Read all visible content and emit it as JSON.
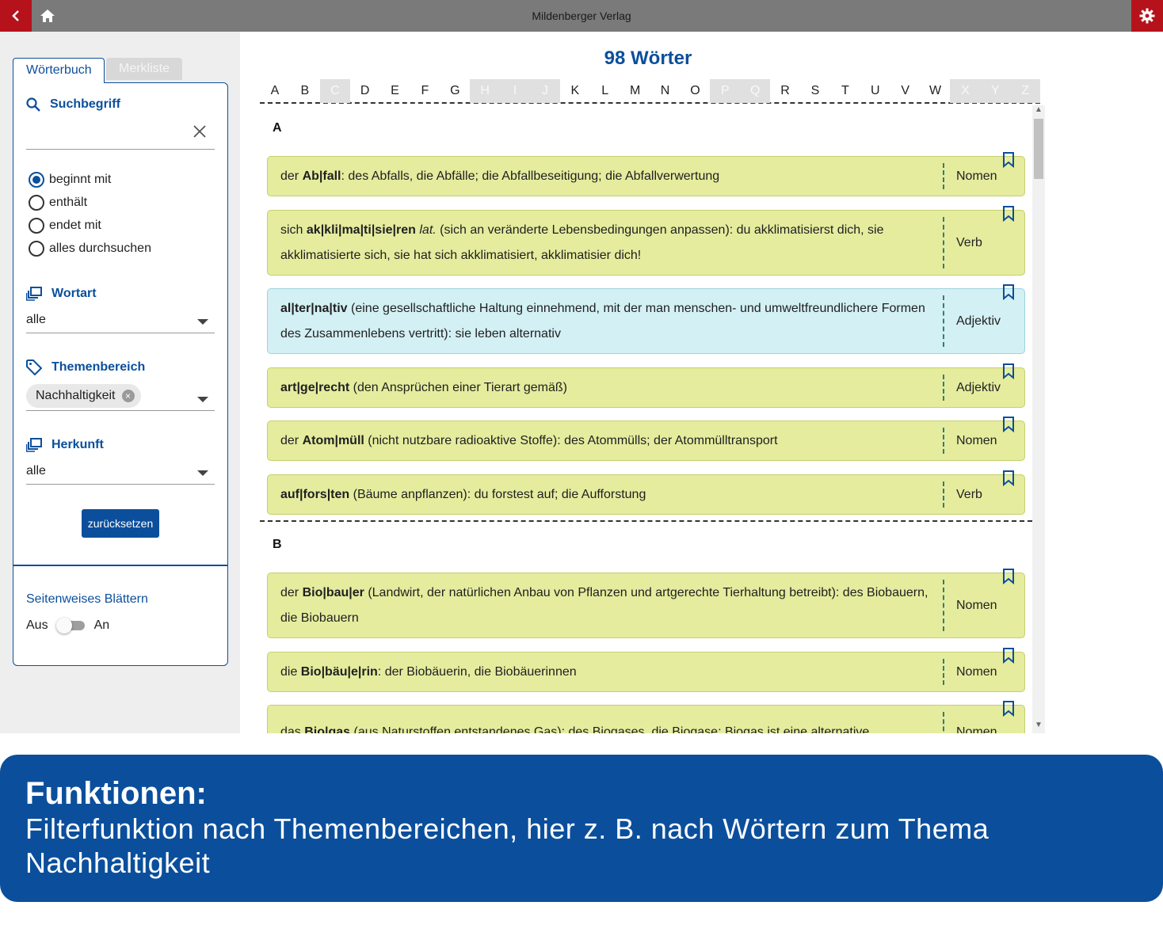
{
  "app": {
    "title": "Mildenberger Verlag"
  },
  "sidebar": {
    "tabs": [
      {
        "label": "Wörterbuch",
        "active": true
      },
      {
        "label": "Merkliste",
        "active": false
      }
    ],
    "search": {
      "title": "Suchbegriff",
      "value": "",
      "placeholder": ""
    },
    "search_modes": [
      {
        "label": "beginnt mit",
        "selected": true
      },
      {
        "label": "enthält",
        "selected": false
      },
      {
        "label": "endet mit",
        "selected": false
      },
      {
        "label": "alles durchsuchen",
        "selected": false
      }
    ],
    "wortart": {
      "title": "Wortart",
      "value": "alle"
    },
    "themenbereich": {
      "title": "Themenbereich",
      "chip": "Nachhaltigkeit"
    },
    "herkunft": {
      "title": "Herkunft",
      "value": "alle"
    },
    "reset_label": "zurücksetzen",
    "paging": {
      "title": "Seitenweises Blättern",
      "off_label": "Aus",
      "on_label": "An",
      "enabled": false
    }
  },
  "main": {
    "count": "98 Wörter",
    "alphabet": [
      {
        "l": "A",
        "on": true
      },
      {
        "l": "B",
        "on": true
      },
      {
        "l": "C",
        "on": false
      },
      {
        "l": "D",
        "on": true
      },
      {
        "l": "E",
        "on": true
      },
      {
        "l": "F",
        "on": true
      },
      {
        "l": "G",
        "on": true
      },
      {
        "l": "H",
        "on": false
      },
      {
        "l": "I",
        "on": false
      },
      {
        "l": "J",
        "on": false
      },
      {
        "l": "K",
        "on": true
      },
      {
        "l": "L",
        "on": true
      },
      {
        "l": "M",
        "on": true
      },
      {
        "l": "N",
        "on": true
      },
      {
        "l": "O",
        "on": true
      },
      {
        "l": "P",
        "on": false
      },
      {
        "l": "Q",
        "on": false
      },
      {
        "l": "R",
        "on": true
      },
      {
        "l": "S",
        "on": true
      },
      {
        "l": "T",
        "on": true
      },
      {
        "l": "U",
        "on": true
      },
      {
        "l": "V",
        "on": true
      },
      {
        "l": "W",
        "on": true
      },
      {
        "l": "X",
        "on": false
      },
      {
        "l": "Y",
        "on": false
      },
      {
        "l": "Z",
        "on": false
      }
    ],
    "groups": [
      {
        "letter": "A",
        "entries": [
          {
            "pre": "der ",
            "word": "Ab|fall",
            "rest": ": des Abfalls, die Abfälle; die Abfallbeseitigung; die Abfallverwertung",
            "pos": "Nomen"
          },
          {
            "pre": "sich ",
            "word": "ak|kli|ma|ti|sie|ren",
            "italic": "lat.",
            "rest": " (sich an veränderte Lebensbedingungen anpassen): du akklimatisierst dich, sie akklimatisierte sich, sie hat sich akklimatisiert, akklimatisier dich!",
            "pos": "Verb"
          },
          {
            "pre": "",
            "word": "al|ter|na|tiv",
            "rest": " (eine gesellschaftliche Haltung einnehmend, mit der man menschen- und umweltfreundlichere Formen des Zusammenlebens vertritt): sie leben alternativ",
            "pos": "Adjektiv",
            "highlight": true
          },
          {
            "pre": "",
            "word": "art|ge|recht",
            "rest": " (den Ansprüchen einer Tierart gemäß)",
            "pos": "Adjektiv"
          },
          {
            "pre": "der ",
            "word": "Atom|müll",
            "rest": " (nicht nutzbare radioaktive Stoffe): des Atommülls; der Atommülltransport",
            "pos": "Nomen"
          },
          {
            "pre": "",
            "word": "auf|fors|ten",
            "rest": " (Bäume anpflanzen): du forstest auf; die Aufforstung",
            "pos": "Verb"
          }
        ]
      },
      {
        "letter": "B",
        "entries": [
          {
            "pre": "der ",
            "word": "Bio|bau|er",
            "rest": " (Landwirt, der natürlichen Anbau von Pflanzen und artgerechte Tierhaltung betreibt): des Biobauern, die Biobauern",
            "pos": "Nomen"
          },
          {
            "pre": "die ",
            "word": "Bio|bäu|e|rin",
            "rest": ": der Biobäuerin, die Biobäuerinnen",
            "pos": "Nomen"
          },
          {
            "pre": "das ",
            "word": "Bio|gas",
            "rest": " (aus Naturstoffen entstandenes Gas): des Biogases, die Biogase; Biogas ist eine alternative",
            "pos": "Nomen"
          }
        ]
      }
    ]
  },
  "banner": {
    "heading": "Funktionen:",
    "text": "Filterfunktion nach Themenbereichen, hier z. B. nach Wörtern zum Thema Nachhaltigkeit"
  },
  "colors": {
    "brand_blue": "#0b4f9c",
    "accent_red": "#b5121b",
    "entry_green": "#e5ec9e",
    "entry_blue": "#d3f0f4"
  },
  "icons": [
    "back-icon",
    "home-icon",
    "gear-icon",
    "search-icon",
    "close-icon",
    "layers-icon",
    "tag-icon",
    "bookmark-icon",
    "chevron-down-icon"
  ]
}
